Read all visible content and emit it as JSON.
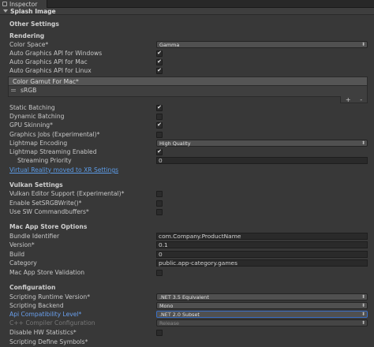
{
  "window": {
    "tab_label": "Inspector"
  },
  "section": {
    "title": "Splash Image"
  },
  "other_settings": {
    "title": "Other Settings"
  },
  "rendering": {
    "header": "Rendering",
    "color_space": {
      "label": "Color Space*",
      "value": "Gamma"
    },
    "auto_api_windows": {
      "label": "Auto Graphics API  for Windows",
      "checked": true
    },
    "auto_api_mac": {
      "label": "Auto Graphics API  for Mac",
      "checked": true
    },
    "auto_api_linux": {
      "label": "Auto Graphics API  for Linux",
      "checked": true
    },
    "gamut_list": {
      "header": "Color Gamut For Mac*",
      "items": [
        "sRGB"
      ],
      "add": "+",
      "remove": "-"
    },
    "static_batching": {
      "label": "Static Batching",
      "checked": true
    },
    "dynamic_batching": {
      "label": "Dynamic Batching",
      "checked": false
    },
    "gpu_skinning": {
      "label": "GPU Skinning*",
      "checked": true
    },
    "graphics_jobs": {
      "label": "Graphics Jobs (Experimental)*",
      "checked": false
    },
    "lightmap_encoding": {
      "label": "Lightmap Encoding",
      "value": "High Quality"
    },
    "lightmap_streaming": {
      "label": "Lightmap Streaming Enabled",
      "checked": true
    },
    "streaming_priority": {
      "label": "Streaming Priority",
      "value": "0"
    },
    "vr_link": "Virtual Reality moved to XR Settings"
  },
  "vulkan": {
    "header": "Vulkan Settings",
    "editor_support": {
      "label": "Vulkan Editor Support (Experimental)*",
      "checked": false
    },
    "set_srgb_write": {
      "label": "Enable SetSRGBWrite()*",
      "checked": false
    },
    "sw_commandbuffers": {
      "label": "Use SW Commandbuffers*",
      "checked": false
    }
  },
  "mac_store": {
    "header": "Mac App Store Options",
    "bundle_identifier": {
      "label": "Bundle Identifier",
      "value": "com.Company.ProductName"
    },
    "version": {
      "label": "Version*",
      "value": "0.1"
    },
    "build": {
      "label": "Build",
      "value": "0"
    },
    "category": {
      "label": "Category",
      "value": "public.app-category.games"
    },
    "validation": {
      "label": "Mac App Store Validation",
      "checked": false
    }
  },
  "configuration": {
    "header": "Configuration",
    "runtime_version": {
      "label": "Scripting Runtime Version*",
      "value": ".NET 3.5 Equivalent"
    },
    "scripting_backend": {
      "label": "Scripting Backend",
      "value": "Mono"
    },
    "api_compat": {
      "label": "Api Compatibility Level*",
      "value": ".NET 2.0 Subset"
    },
    "cpp_config": {
      "label": "C++ Compiler Configuration",
      "value": "Release"
    },
    "hw_statistics": {
      "label": "Disable HW Statistics*",
      "checked": false
    },
    "define_symbols": {
      "label": "Scripting Define Symbols*"
    }
  }
}
